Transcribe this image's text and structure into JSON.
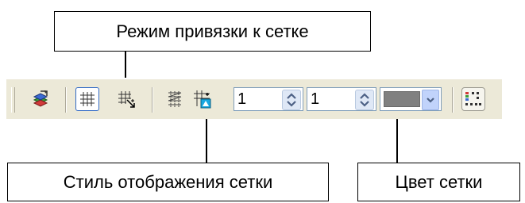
{
  "callouts": {
    "snap_mode": "Режим привязки к сетке",
    "display_style": "Стиль отображения сетки",
    "grid_color": "Цвет сетки"
  },
  "toolbar": {
    "icons": {
      "grid_settings": "grid-settings-icon",
      "show_grid": "grid-show-icon",
      "snap_to_grid": "grid-snap-icon",
      "grid_style": "grid-style-icon",
      "grid_origin": "grid-origin-icon",
      "grid_properties": "grid-properties-icon"
    },
    "spacing_x_value": "1",
    "spacing_y_value": "1",
    "grid_color_hex": "#808080",
    "show_grid_pressed": true
  }
}
